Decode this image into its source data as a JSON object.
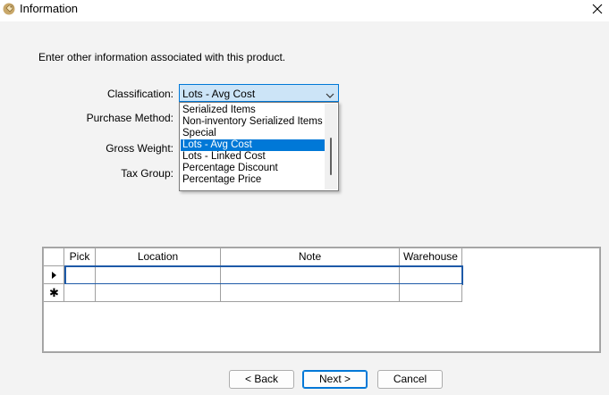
{
  "window": {
    "title": "Information",
    "icon": "tag-icon",
    "close_glyph": "✕"
  },
  "intro_text": "Enter other information associated with this product.",
  "form": {
    "classification_label": "Classification:",
    "purchase_method_label": "Purchase Method:",
    "gross_weight_label": "Gross Weight:",
    "tax_group_label": "Tax Group:",
    "classification_value": "Lots - Avg Cost"
  },
  "dropdown": {
    "items": [
      "Serialized Items",
      "Non-inventory Serialized Items",
      "Special",
      "Lots - Avg Cost",
      "Lots - Linked Cost",
      "Percentage Discount",
      "Percentage Price"
    ],
    "selected_index": 3
  },
  "grid": {
    "columns": [
      "Pick",
      "Location",
      "Note",
      "Warehouse"
    ],
    "rows": [
      {
        "marker": "current-row-arrow",
        "cells": [
          "",
          "",
          "",
          ""
        ]
      },
      {
        "marker": "new-row-asterisk",
        "cells": [
          "",
          "",
          "",
          ""
        ]
      }
    ]
  },
  "buttons": {
    "back": "< Back",
    "next": "Next >",
    "cancel": "Cancel"
  },
  "colors": {
    "accent": "#0078d7",
    "combo_bg": "#cce4f7",
    "client_bg": "#f3f3f3"
  }
}
